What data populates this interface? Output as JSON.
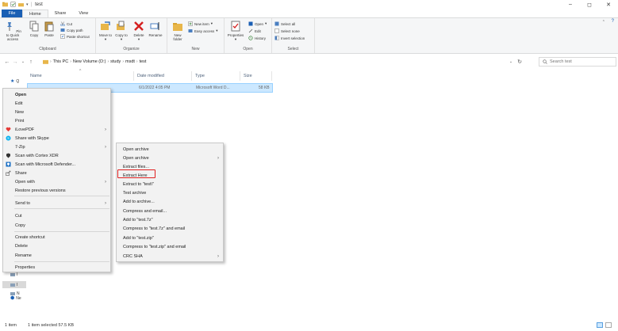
{
  "window": {
    "title": "test"
  },
  "ribbon_tabs": [
    {
      "label": "File"
    },
    {
      "label": "Home"
    },
    {
      "label": "Share"
    },
    {
      "label": "View"
    }
  ],
  "ribbon": {
    "clipboard": {
      "label": "Clipboard",
      "pin": "Pin to Quick access",
      "copy": "Copy",
      "paste": "Paste",
      "cut": "Cut",
      "copy_path": "Copy path",
      "paste_shortcut": "Paste shortcut"
    },
    "organize": {
      "label": "Organize",
      "move_to": "Move to",
      "copy_to": "Copy to",
      "delete": "Delete",
      "rename": "Rename"
    },
    "new": {
      "label": "New",
      "new_folder": "New folder",
      "new_item": "New item",
      "easy_access": "Easy access"
    },
    "open": {
      "label": "Open",
      "properties": "Properties",
      "open": "Open",
      "edit": "Edit",
      "history": "History"
    },
    "select": {
      "label": "Select",
      "select_all": "Select all",
      "select_none": "Select none",
      "invert_selection": "Invert selection"
    }
  },
  "address": {
    "segments": [
      "This PC",
      "New Volume (D:)",
      "study",
      "msdt",
      "test"
    ],
    "search_placeholder": "Search test"
  },
  "columns": {
    "name": "Name",
    "date_modified": "Date modified",
    "type": "Type",
    "size": "Size"
  },
  "file": {
    "date": "6/1/2022 4:05 PM",
    "type": "Microsoft Word D...",
    "size": "58 KB"
  },
  "nav": {
    "quick_access": "Q",
    "item1": "I",
    "item2": "I",
    "item3": "N",
    "network": "Ne"
  },
  "context_menu": [
    {
      "label": "Open",
      "bold": true
    },
    {
      "label": "Edit"
    },
    {
      "label": "New"
    },
    {
      "label": "Print"
    },
    {
      "label": "iLovePDF",
      "submenu": true
    },
    {
      "label": "Share with Skype"
    },
    {
      "label": "7-Zip",
      "submenu": true
    },
    {
      "label": "Scan with Cortex XDR"
    },
    {
      "label": "Scan with Microsoft Defender..."
    },
    {
      "label": "Share"
    },
    {
      "label": "Open with",
      "submenu": true
    },
    {
      "label": "Restore previous versions"
    },
    {
      "label": "Send to",
      "submenu": true
    },
    {
      "label": "Cut"
    },
    {
      "label": "Copy"
    },
    {
      "label": "Create shortcut"
    },
    {
      "label": "Delete"
    },
    {
      "label": "Rename"
    },
    {
      "label": "Properties"
    }
  ],
  "submenu_7zip": [
    {
      "label": "Open archive"
    },
    {
      "label": "Open archive",
      "submenu": true
    },
    {
      "label": "Extract files..."
    },
    {
      "label": "Extract Here"
    },
    {
      "label": "Extract to \"test\\\""
    },
    {
      "label": "Test archive"
    },
    {
      "label": "Add to archive..."
    },
    {
      "label": "Compress and email..."
    },
    {
      "label": "Add to \"test.7z\""
    },
    {
      "label": "Compress to \"test.7z\" and email"
    },
    {
      "label": "Add to \"test.zip\""
    },
    {
      "label": "Compress to \"test.zip\" and email"
    },
    {
      "label": "CRC SHA",
      "submenu": true
    }
  ],
  "status": {
    "count": "1 item",
    "selected": "1 item selected  57.5 KB"
  },
  "colors": {
    "file_tab": "#1a5fb4",
    "selection": "#cce8ff",
    "highlight": "#e02020"
  }
}
